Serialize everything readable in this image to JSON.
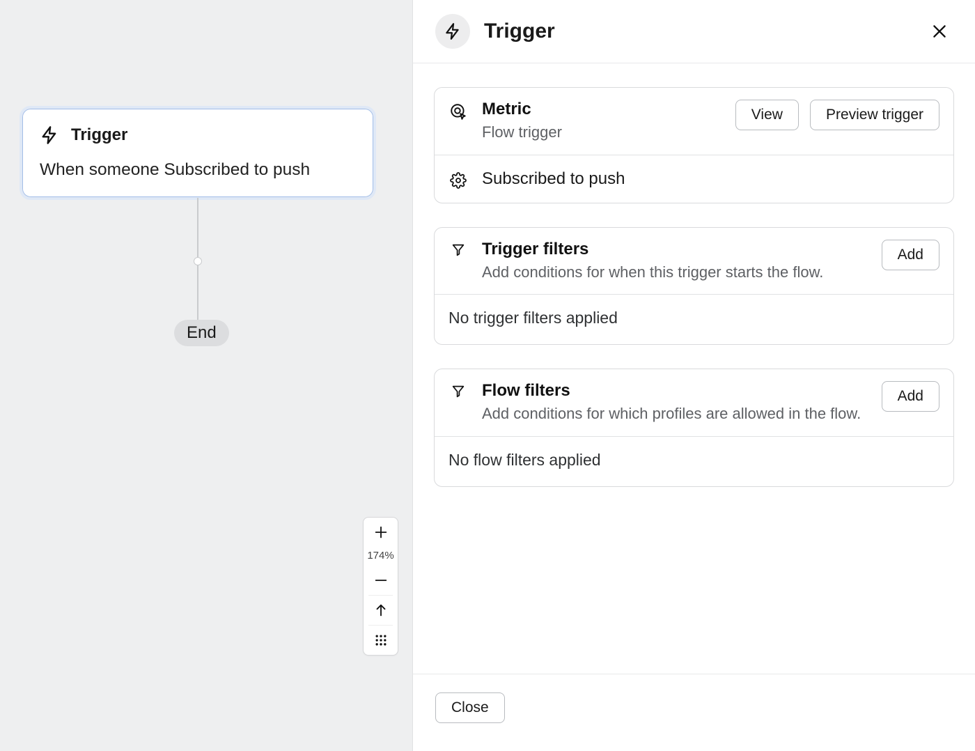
{
  "canvas": {
    "trigger_node": {
      "title": "Trigger",
      "desc": "When someone Subscribed to push"
    },
    "end_label": "End",
    "zoom": {
      "level": "174%"
    }
  },
  "panel": {
    "title": "Trigger",
    "metric": {
      "title": "Metric",
      "subtitle": "Flow trigger",
      "view_label": "View",
      "preview_label": "Preview trigger",
      "value": "Subscribed to push"
    },
    "trigger_filters": {
      "title": "Trigger filters",
      "subtitle": "Add conditions for when this trigger starts the flow.",
      "add_label": "Add",
      "status": "No trigger filters applied"
    },
    "flow_filters": {
      "title": "Flow filters",
      "subtitle": "Add conditions for which profiles are allowed in the flow.",
      "add_label": "Add",
      "status": "No flow filters applied"
    },
    "close_label": "Close"
  }
}
